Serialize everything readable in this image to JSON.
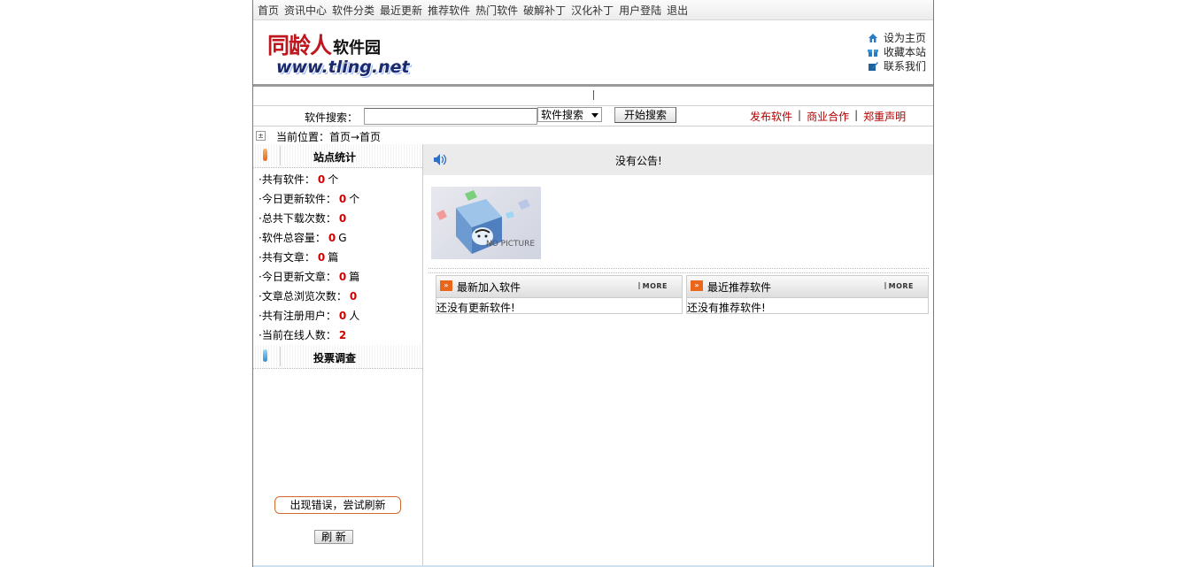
{
  "nav": [
    "首页",
    "资讯中心",
    "软件分类",
    "最近更新",
    "推荐软件",
    "热门软件",
    "破解补丁",
    "汉化补丁",
    "用户登陆",
    "退出"
  ],
  "logo": {
    "line1": "同龄人",
    "line1b": "软件园",
    "line2": "www.tling.net"
  },
  "toplinks": [
    {
      "label": "设为主页",
      "icon": "home-icon"
    },
    {
      "label": "收藏本站",
      "icon": "gift-icon"
    },
    {
      "label": "联系我们",
      "icon": "pen-icon"
    }
  ],
  "search": {
    "label": "软件搜索：",
    "input_value": "",
    "select_value": "软件搜索",
    "button": "开始搜索"
  },
  "rightlinks": [
    "发布软件",
    "商业合作",
    "郑重声明"
  ],
  "breadcrumb": {
    "box": "±",
    "text": "当前位置：首页→首页"
  },
  "sidebar": {
    "stats_title": "站点统计",
    "stats": [
      {
        "label": "·共有软件：",
        "value": "0",
        "unit": "个"
      },
      {
        "label": "·今日更新软件：",
        "value": "0",
        "unit": "个"
      },
      {
        "label": "·总共下载次数：",
        "value": "0",
        "unit": ""
      },
      {
        "label": "·软件总容量：",
        "value": "0",
        "unit": "G"
      },
      {
        "label": "·共有文章：",
        "value": "0",
        "unit": "篇"
      },
      {
        "label": "·今日更新文章：",
        "value": "0",
        "unit": "篇"
      },
      {
        "label": "·文章总浏览次数：",
        "value": "0",
        "unit": ""
      },
      {
        "label": "·共有注册用户：",
        "value": "0",
        "unit": "人"
      },
      {
        "label": "·当前在线人数：",
        "value": "2",
        "unit": ""
      }
    ],
    "vote_title": "投票调查",
    "error_button": "出现错误，尝试刷新",
    "refresh_button": "刷 新"
  },
  "main": {
    "notice": "没有公告!",
    "nopic_label": "NO PICTURE",
    "panels": [
      {
        "title": "最新加入软件",
        "more": "MORE",
        "body": "还没有更新软件!"
      },
      {
        "title": "最近推荐软件",
        "more": "MORE",
        "body": "还没有推荐软件!"
      }
    ]
  },
  "colors": {
    "accent_red": "#d00000",
    "link_red": "#b00000",
    "orange": "#e9661b"
  }
}
